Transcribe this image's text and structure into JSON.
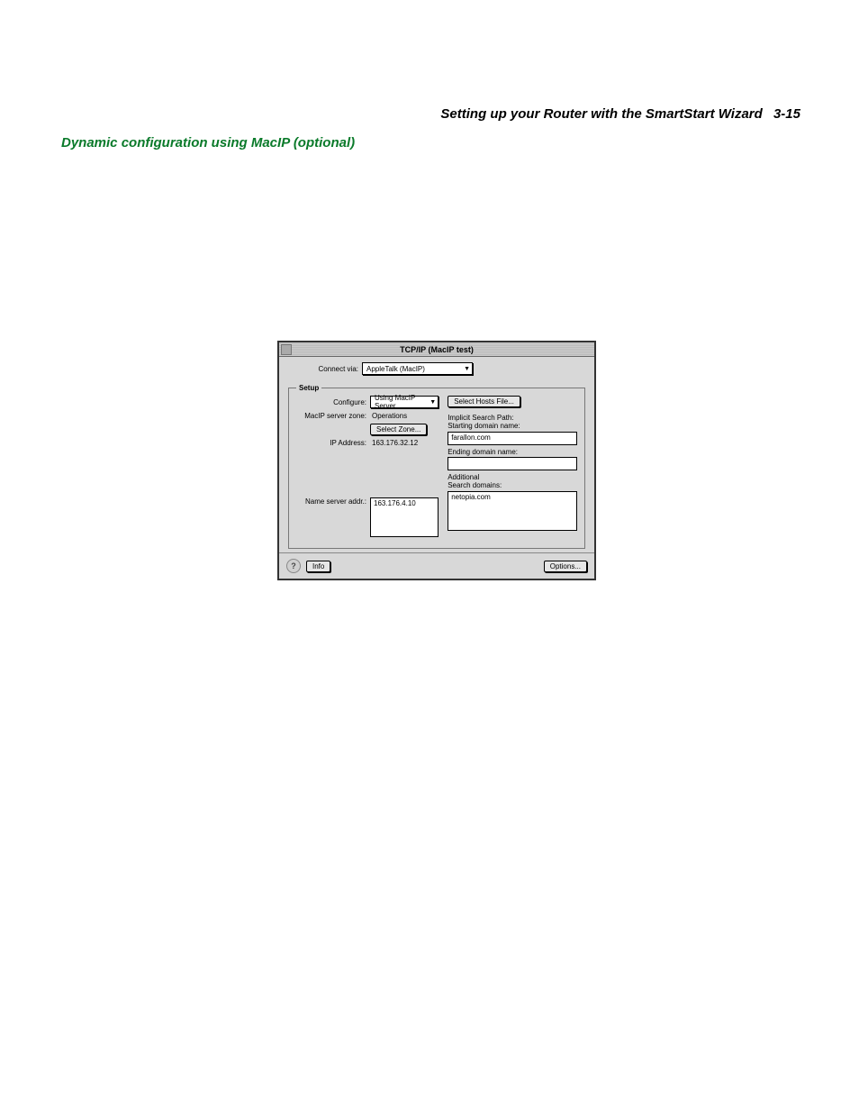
{
  "header": {
    "text": "Setting up your Router with the SmartStart Wizard",
    "page": "3-15"
  },
  "section_heading": "Dynamic configuration using MacIP (optional)",
  "window": {
    "title": "TCP/IP (MacIP test)",
    "connect_via_label": "Connect via:",
    "connect_via_value": "AppleTalk (MacIP)",
    "setup_legend": "Setup",
    "configure_label": "Configure:",
    "configure_value": "Using MacIP Server",
    "select_hosts_btn": "Select Hosts File...",
    "zone_label": "MacIP server zone:",
    "zone_value": "Operations",
    "select_zone_btn": "Select Zone...",
    "implicit_label_1": "Implicit Search Path:",
    "implicit_label_2": "Starting domain name:",
    "ip_label": "IP Address:",
    "ip_value": "163.176.32.12",
    "start_domain_value": "farallon.com",
    "end_domain_label": "Ending domain name:",
    "end_domain_value": "",
    "addl_label_1": "Additional",
    "addl_label_2": "Search domains:",
    "nameserver_label": "Name server addr.:",
    "nameserver_value": "163.176.4.10",
    "addl_domain_value": "netopia.com",
    "info_btn": "Info",
    "options_btn": "Options..."
  }
}
